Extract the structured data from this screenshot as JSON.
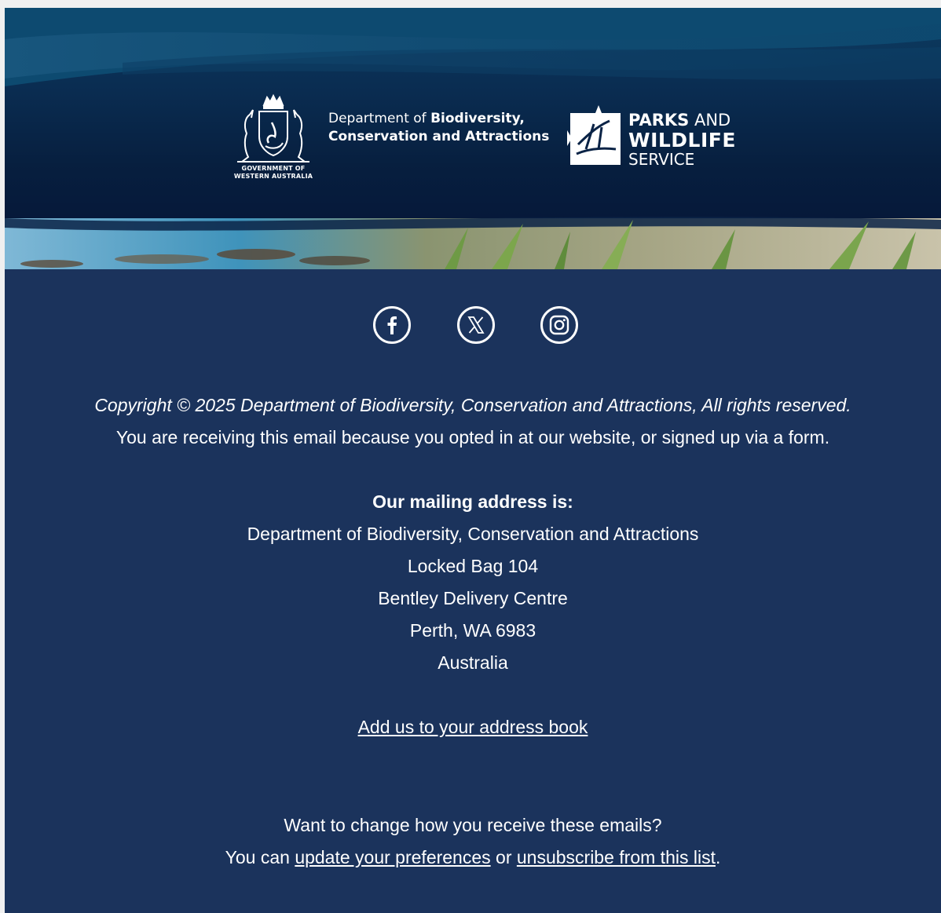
{
  "header": {
    "crest_caption_line1": "GOVERNMENT OF",
    "crest_caption_line2": "WESTERN AUSTRALIA",
    "dept_line1_prefix": "Department of ",
    "dept_line1_bold": "Biodiversity,",
    "dept_line2": "Conservation and Attractions",
    "pws_parks": "PARKS",
    "pws_and": " AND",
    "pws_wildlife": "WILDLIFE",
    "pws_service": "SERVICE"
  },
  "social": {
    "items": [
      {
        "name": "facebook",
        "icon": "facebook-icon"
      },
      {
        "name": "x",
        "icon": "x-icon"
      },
      {
        "name": "instagram",
        "icon": "instagram-icon"
      }
    ]
  },
  "footer": {
    "copyright": "Copyright © 2025 Department of Biodiversity, Conservation and Attractions, All rights reserved.",
    "reason": "You are receiving this email because you opted in at our website, or signed up via a form.",
    "address_heading": "Our mailing address is:",
    "address_lines": [
      "Department of Biodiversity, Conservation and Attractions",
      "Locked Bag 104",
      "Bentley Delivery Centre",
      "Perth, WA 6983",
      "Australia"
    ],
    "address_book_link": "Add us to your address book",
    "change_question": "Want to change how you receive these emails?",
    "change_prefix": "You can ",
    "preferences_link": "update your preferences",
    "change_or": " or ",
    "unsubscribe_link": "unsubscribe from this list",
    "change_suffix": "."
  },
  "colors": {
    "footer_bg": "#1b335c",
    "text": "#ffffff"
  }
}
